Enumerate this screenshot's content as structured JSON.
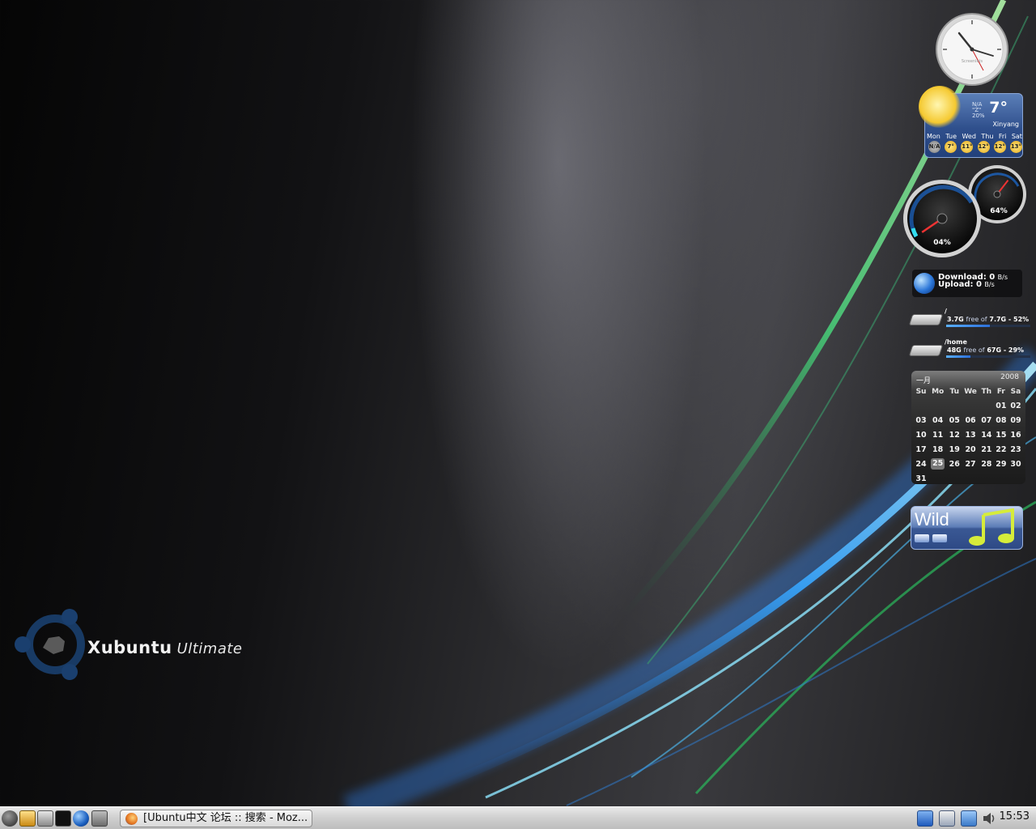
{
  "desktop": {
    "logo": {
      "brand": "Xubuntu",
      "edition": "Ultimate"
    }
  },
  "clock_desklet": {
    "label": "Screenlets"
  },
  "weather": {
    "condition_lines": [
      "N/A",
      "\"Z\"",
      "20%"
    ],
    "temperature": "7°",
    "city": "Xinyang",
    "days": [
      "Mon",
      "Tue",
      "Wed",
      "Thu",
      "Fri",
      "Sat"
    ],
    "forecast": [
      "N/A",
      "7°",
      "11°",
      "12°",
      "12°",
      "13°"
    ]
  },
  "gauges": {
    "cpu": "04%",
    "memory": "64%",
    "cpu_value": 4,
    "memory_value": 64
  },
  "network": {
    "download_label": "Download:",
    "download_value": "0",
    "download_unit": "B/s",
    "upload_label": "Upload:",
    "upload_value": "0",
    "upload_unit": "B/s"
  },
  "disks": [
    {
      "path": "/",
      "free": "3.7G",
      "free_word": "free of",
      "total": "7.7G - 52%",
      "used_fraction": 0.52
    },
    {
      "path": "/home",
      "free": "48G",
      "free_word": "free of",
      "total": "67G - 29%",
      "used_fraction": 0.29
    }
  ],
  "calendar": {
    "month": "一月",
    "year": "2008",
    "weekdays": [
      "Su",
      "Mo",
      "Tu",
      "We",
      "Th",
      "Fr",
      "Sa"
    ],
    "weeks": [
      [
        "",
        "",
        "",
        "",
        "",
        "01",
        "02"
      ],
      [
        "03",
        "04",
        "05",
        "06",
        "07",
        "08",
        "09"
      ],
      [
        "10",
        "11",
        "12",
        "13",
        "14",
        "15",
        "16"
      ],
      [
        "17",
        "18",
        "19",
        "20",
        "21",
        "22",
        "23"
      ],
      [
        "24",
        "25",
        "26",
        "27",
        "28",
        "29",
        "30"
      ],
      [
        "31",
        "",
        "",
        "",
        "",
        "",
        ""
      ]
    ],
    "today": "25"
  },
  "music": {
    "title": "Wild"
  },
  "taskbar": {
    "window_title": "[Ubuntu中文 论坛 :: 搜索 - Moz...",
    "time": "15:53"
  }
}
